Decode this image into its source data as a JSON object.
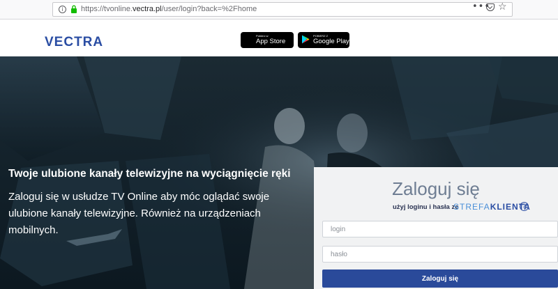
{
  "browser": {
    "url_prefix": "https://tvonline.",
    "url_domain": "vectra.pl",
    "url_path": "/user/login?back=%2Fhome"
  },
  "header": {
    "logo": "VECTRA",
    "app_store": {
      "small": "Pobierz w",
      "big": "App Store"
    },
    "google_play": {
      "small": "POBIERZ Z",
      "big": "Google Play"
    }
  },
  "hero": {
    "tagline": "Twoje ulubione kanały telewizyjne na wyciągnięcie ręki",
    "description": "Zaloguj się w usłudze TV Online aby móc oglądać swoje ulubione kanały telewizyjne. Również na urządzeniach mobilnych."
  },
  "login": {
    "title": "Zaloguj się",
    "subtitle": "użyj loginu i hasła ze",
    "strefa_part1": "STREFA",
    "strefa_part2": "KLIENTA",
    "help": "?",
    "login_placeholder": "login",
    "password_placeholder": "hasło",
    "submit_label": "Zaloguj się"
  },
  "colors": {
    "brand": "#2a4da3",
    "button": "#2a4a9a",
    "panel": "#f1f2f3",
    "hero_dark": "#122029"
  }
}
